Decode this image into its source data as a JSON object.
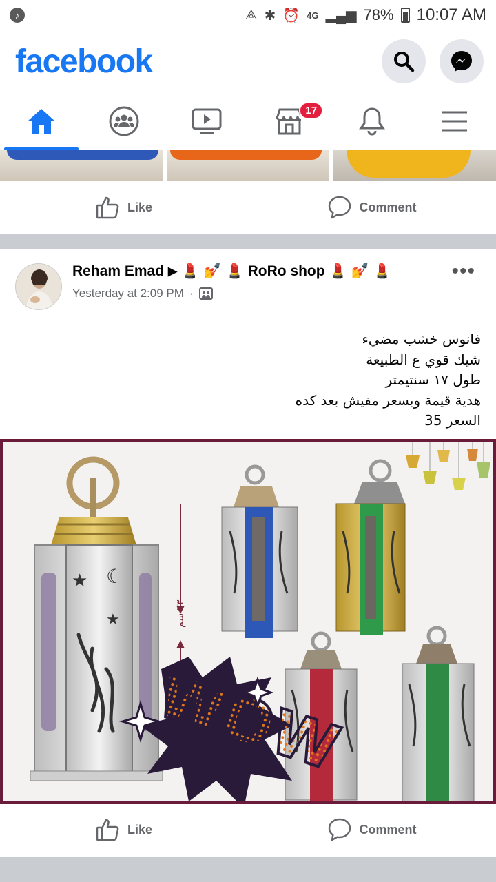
{
  "status_bar": {
    "battery": "78%",
    "time": "10:07 AM",
    "network": "4G"
  },
  "header": {
    "logo": "facebook"
  },
  "nav": {
    "marketplace_badge": "17"
  },
  "actions": {
    "like": "Like",
    "comment": "Comment"
  },
  "post": {
    "author": "Reham Emad",
    "page": "RoRo shop",
    "time": "Yesterday at 2:09 PM",
    "separator": "·",
    "text_lines": [
      "فانوس خشب مضيء",
      "شيك قوي ع الطبيعة",
      "طول ١٧ سنتيمتر",
      "هدية قيمة وبسعر مفيش بعد كده",
      "السعر 35"
    ],
    "image_text": {
      "size_label": "٢٣ سم",
      "wow": "WOW"
    }
  },
  "colors": {
    "brand": "#1877f2",
    "badge": "#e41e3f",
    "muted": "#65676b",
    "divider": "#c9ccd1",
    "frame": "#6b1b3a"
  }
}
